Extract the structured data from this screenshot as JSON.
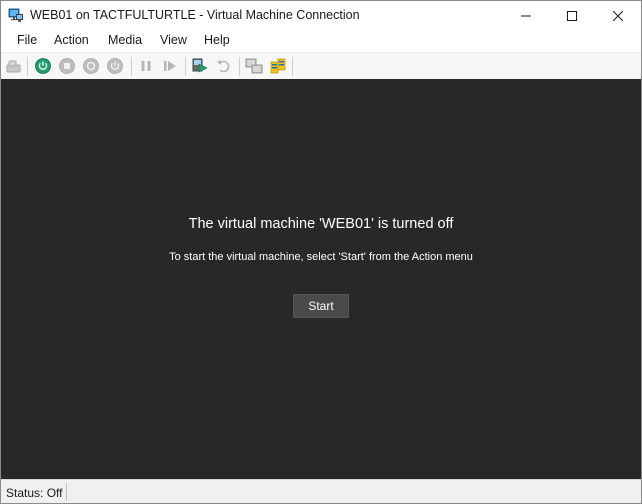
{
  "window": {
    "title": "WEB01 on TACTFULTURTLE - Virtual Machine Connection"
  },
  "menu": {
    "items": [
      {
        "label": "File"
      },
      {
        "label": "Action"
      },
      {
        "label": "Media"
      },
      {
        "label": "View"
      },
      {
        "label": "Help"
      }
    ]
  },
  "toolbar": {
    "buttons": [
      {
        "icon": "ctrl-alt-del-icon",
        "enabled": false
      },
      {
        "icon": "start-icon",
        "enabled": true,
        "color": "#1e9e6a"
      },
      {
        "icon": "turn-off-icon",
        "enabled": false
      },
      {
        "icon": "shutdown-icon",
        "enabled": false
      },
      {
        "icon": "save-icon",
        "enabled": false
      },
      {
        "icon": "pause-icon",
        "enabled": false
      },
      {
        "icon": "resume-icon",
        "enabled": false
      },
      {
        "icon": "checkpoint-icon",
        "enabled": true
      },
      {
        "icon": "revert-icon",
        "enabled": false
      },
      {
        "icon": "enhanced-session-icon",
        "enabled": false
      },
      {
        "icon": "share-icon",
        "enabled": true
      }
    ]
  },
  "screen": {
    "title": "The virtual machine 'WEB01' is turned off",
    "subtitle": "To start the virtual machine, select 'Start' from the Action menu",
    "start_label": "Start",
    "background": "#282828"
  },
  "status": {
    "text": "Status: Off"
  }
}
